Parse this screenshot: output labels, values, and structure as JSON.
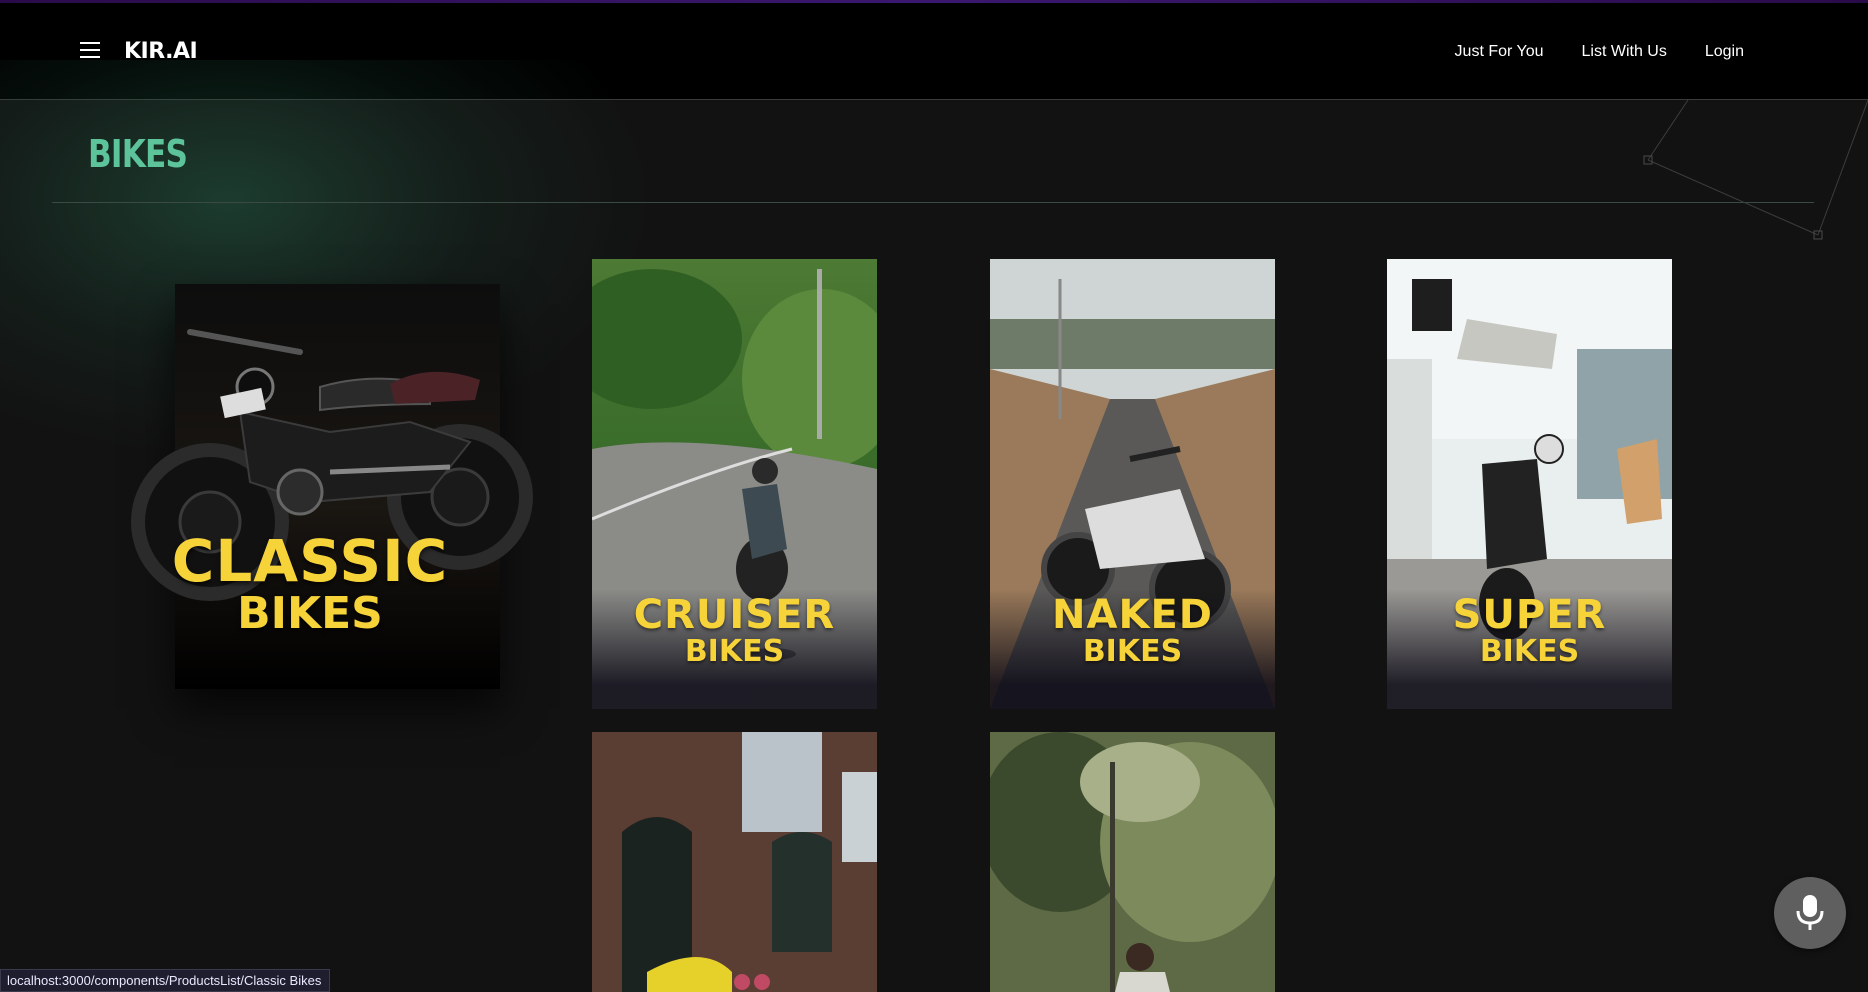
{
  "header": {
    "logo": "KIR.AI",
    "nav": [
      "Just For You",
      "List With Us",
      "Login"
    ]
  },
  "page": {
    "title": "BIKES"
  },
  "categories": [
    {
      "line1": "CLASSIC",
      "line2": "BIKES"
    },
    {
      "line1": "CRUISER",
      "line2": "BIKES"
    },
    {
      "line1": "NAKED",
      "line2": "BIKES"
    },
    {
      "line1": "SUPER",
      "line2": "BIKES"
    }
  ],
  "status_bar": {
    "url": "localhost:3000/components/ProductsList/Classic Bikes"
  },
  "icons": {
    "menu": "hamburger-menu-icon",
    "mic": "microphone-icon"
  },
  "colors": {
    "accent": "#5cc39a",
    "label": "#f7d33a",
    "background": "#121212"
  }
}
